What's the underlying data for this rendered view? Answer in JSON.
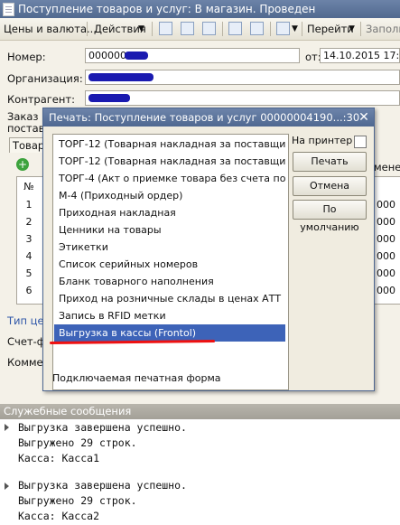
{
  "window": {
    "title": "Поступление товаров и услуг: В магазин. Проведен"
  },
  "toolbar": {
    "prices_label": "Цены и валюта...",
    "actions_label": "Действия",
    "goto_label": "Перейти",
    "fill_label": "Заполн"
  },
  "form": {
    "number_label": "Номер:",
    "number_value": "00000000",
    "date_label": "от:",
    "date_value": "14.10.2015 17:32",
    "org_label": "Организация:",
    "contractor_label": "Контрагент:",
    "order_label": "Заказ",
    "supplier_label": "постав",
    "tab_label": "Товар",
    "type_label": "Тип цен",
    "invoice_label": "Счет-ф",
    "comment_label": "Комме",
    "col_num": "№",
    "col_right": "мене",
    "rows": [
      "1",
      "2",
      "3",
      "4",
      "5",
      "6"
    ],
    "right_vals": [
      "000",
      "000",
      "000",
      "000",
      "000",
      "000"
    ]
  },
  "dialog": {
    "title": "Печать: Поступление товаров и услуг 00000004190...:30",
    "close_glyph": "✕",
    "items": [
      "ТОРГ-12 (Товарная накладная за поставщика ...",
      "ТОРГ-12 (Товарная накладная за поставщика)",
      "ТОРГ-4 (Акт о приемке товара без счета поста...",
      "М-4 (Приходный ордер)",
      "Приходная накладная",
      "Ценники на товары",
      "Этикетки",
      "Список серийных номеров",
      "Бланк товарного наполнения",
      "Приход на розничные склады в ценах АТТ",
      "Запись в RFID метки",
      "Выгрузка в кассы (Frontol)"
    ],
    "selected_index": 11,
    "to_printer_label": "На принтер",
    "print_button": "Печать",
    "cancel_button": "Отмена",
    "default_button": "По умолчанию",
    "footer_note": "Подключаемая печатная форма"
  },
  "messages": {
    "header": "Служебные сообщения",
    "groups": [
      {
        "line1": "Выгрузка завершена успешно.",
        "line2": "Выгружено 29 строк.",
        "line3": "Касса: Касса1"
      },
      {
        "line1": "Выгрузка завершена успешно.",
        "line2": "Выгружено 29 строк.",
        "line3": "Касса: Касса2"
      }
    ]
  },
  "colors": {
    "titlebar": "#51698f",
    "selection": "#3d63b8",
    "annotation": "#e11111",
    "redaction": "#1a1ab0"
  },
  "icons": [
    "document-icon",
    "dropdown-arrow-icon",
    "print-icon",
    "save-icon",
    "refresh-icon",
    "add-row-icon",
    "close-icon",
    "expand-arrow-icon"
  ]
}
